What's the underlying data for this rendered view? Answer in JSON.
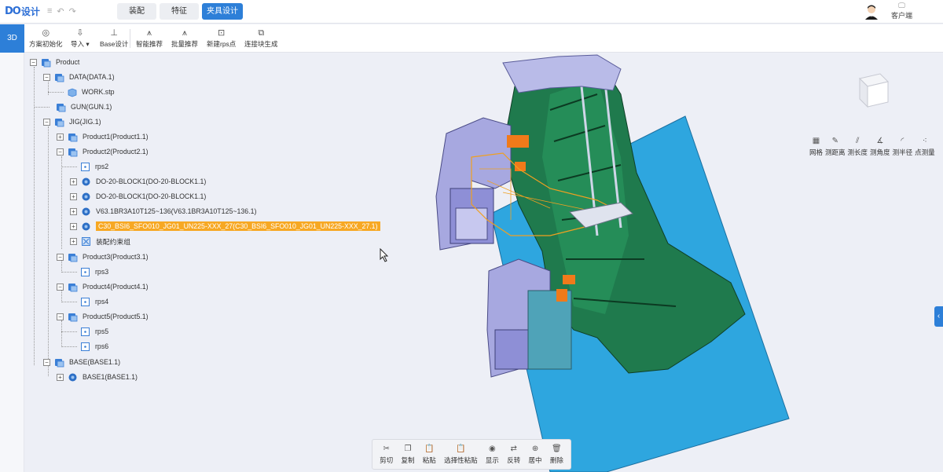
{
  "app": {
    "logo_mark": "DO",
    "logo_name": "设计"
  },
  "top_tabs": [
    {
      "label": "装配",
      "active": false
    },
    {
      "label": "特征",
      "active": false
    },
    {
      "label": "夹具设计",
      "active": true
    }
  ],
  "user": {
    "label": "客户端"
  },
  "mode": "3D",
  "toolbar": [
    {
      "label": "方案初始化",
      "icon": "target-icon"
    },
    {
      "label": "导入 ▾",
      "icon": "import-icon"
    },
    {
      "label": "Base设计",
      "icon": "base-icon"
    },
    {
      "label": "智能推荐",
      "icon": "compass-icon"
    },
    {
      "label": "批量推荐",
      "icon": "compass-icon"
    },
    {
      "label": "新建rps点",
      "icon": "rps-icon"
    },
    {
      "label": "连接块生成",
      "icon": "block-icon"
    }
  ],
  "tree": [
    {
      "label": "Product",
      "level": 0,
      "toggle": "−",
      "icon": "assembly-icon"
    },
    {
      "label": "DATA(DATA.1)",
      "level": 1,
      "toggle": "−",
      "icon": "assembly-icon"
    },
    {
      "label": "WORK.stp",
      "level": 2,
      "toggle": "",
      "icon": "part-icon"
    },
    {
      "label": "GUN(GUN.1)",
      "level": 1,
      "toggle": "",
      "icon": "assembly-icon"
    },
    {
      "label": "JIG(JIG.1)",
      "level": 1,
      "toggle": "−",
      "icon": "assembly-icon"
    },
    {
      "label": "Product1(Product1.1)",
      "level": 2,
      "toggle": "+",
      "icon": "assembly-icon"
    },
    {
      "label": "Product2(Product2.1)",
      "level": 2,
      "toggle": "−",
      "icon": "assembly-icon"
    },
    {
      "label": "rps2",
      "level": 3,
      "toggle": "",
      "icon": "rps-icon"
    },
    {
      "label": "DO-20-BLOCK1(DO-20-BLOCK1.1)",
      "level": 3,
      "toggle": "+",
      "icon": "gear-icon"
    },
    {
      "label": "DO-20-BLOCK1(DO-20-BLOCK1.1)",
      "level": 3,
      "toggle": "+",
      "icon": "gear-icon"
    },
    {
      "label": "V63.1BR3A10T125~136(V63.1BR3A10T125~136.1)",
      "level": 3,
      "toggle": "+",
      "icon": "gear-icon"
    },
    {
      "label": "C30_BSI6_SFO010_JG01_UN225-XXX_27(C30_BSI6_SFO010_JG01_UN225-XXX_27.1)",
      "level": 3,
      "toggle": "+",
      "icon": "gear-icon",
      "selected": true
    },
    {
      "label": "装配约束组",
      "level": 3,
      "toggle": "+",
      "icon": "constraint-icon"
    },
    {
      "label": "Product3(Product3.1)",
      "level": 2,
      "toggle": "−",
      "icon": "assembly-icon"
    },
    {
      "label": "rps3",
      "level": 3,
      "toggle": "",
      "icon": "rps-icon"
    },
    {
      "label": "Product4(Product4.1)",
      "level": 2,
      "toggle": "−",
      "icon": "assembly-icon"
    },
    {
      "label": "rps4",
      "level": 3,
      "toggle": "",
      "icon": "rps-icon"
    },
    {
      "label": "Product5(Product5.1)",
      "level": 2,
      "toggle": "−",
      "icon": "assembly-icon"
    },
    {
      "label": "rps5",
      "level": 3,
      "toggle": "",
      "icon": "rps-icon"
    },
    {
      "label": "rps6",
      "level": 3,
      "toggle": "",
      "icon": "rps-icon"
    },
    {
      "label": "BASE(BASE1.1)",
      "level": 1,
      "toggle": "−",
      "icon": "assembly-icon"
    },
    {
      "label": "BASE1(BASE1.1)",
      "level": 2,
      "toggle": "+",
      "icon": "gear-icon"
    }
  ],
  "measure_tools": [
    {
      "label": "网格",
      "icon": "grid-icon"
    },
    {
      "label": "测距离",
      "icon": "distance-icon"
    },
    {
      "label": "测长度",
      "icon": "length-icon"
    },
    {
      "label": "测角度",
      "icon": "angle-icon"
    },
    {
      "label": "测半径",
      "icon": "radius-icon"
    },
    {
      "label": "点测量",
      "icon": "point-icon"
    }
  ],
  "bottom_tools": [
    {
      "label": "剪切",
      "icon": "scissors-icon"
    },
    {
      "label": "复制",
      "icon": "copy-icon"
    },
    {
      "label": "粘贴",
      "icon": "paste-icon"
    },
    {
      "label": "选择性粘贴",
      "icon": "paste-special-icon"
    },
    {
      "label": "显示",
      "icon": "eye-icon"
    },
    {
      "label": "反转",
      "icon": "invert-icon"
    },
    {
      "label": "居中",
      "icon": "center-icon"
    },
    {
      "label": "删除",
      "icon": "trash-icon"
    }
  ],
  "colors": {
    "accent": "#2d7fd8",
    "selection": "#f7a823",
    "base_plate": "#2ea6df",
    "fixture_green": "#1f7a4d",
    "clamp_purple": "#8e8fd6",
    "highlight_orange": "#f07a1a"
  }
}
